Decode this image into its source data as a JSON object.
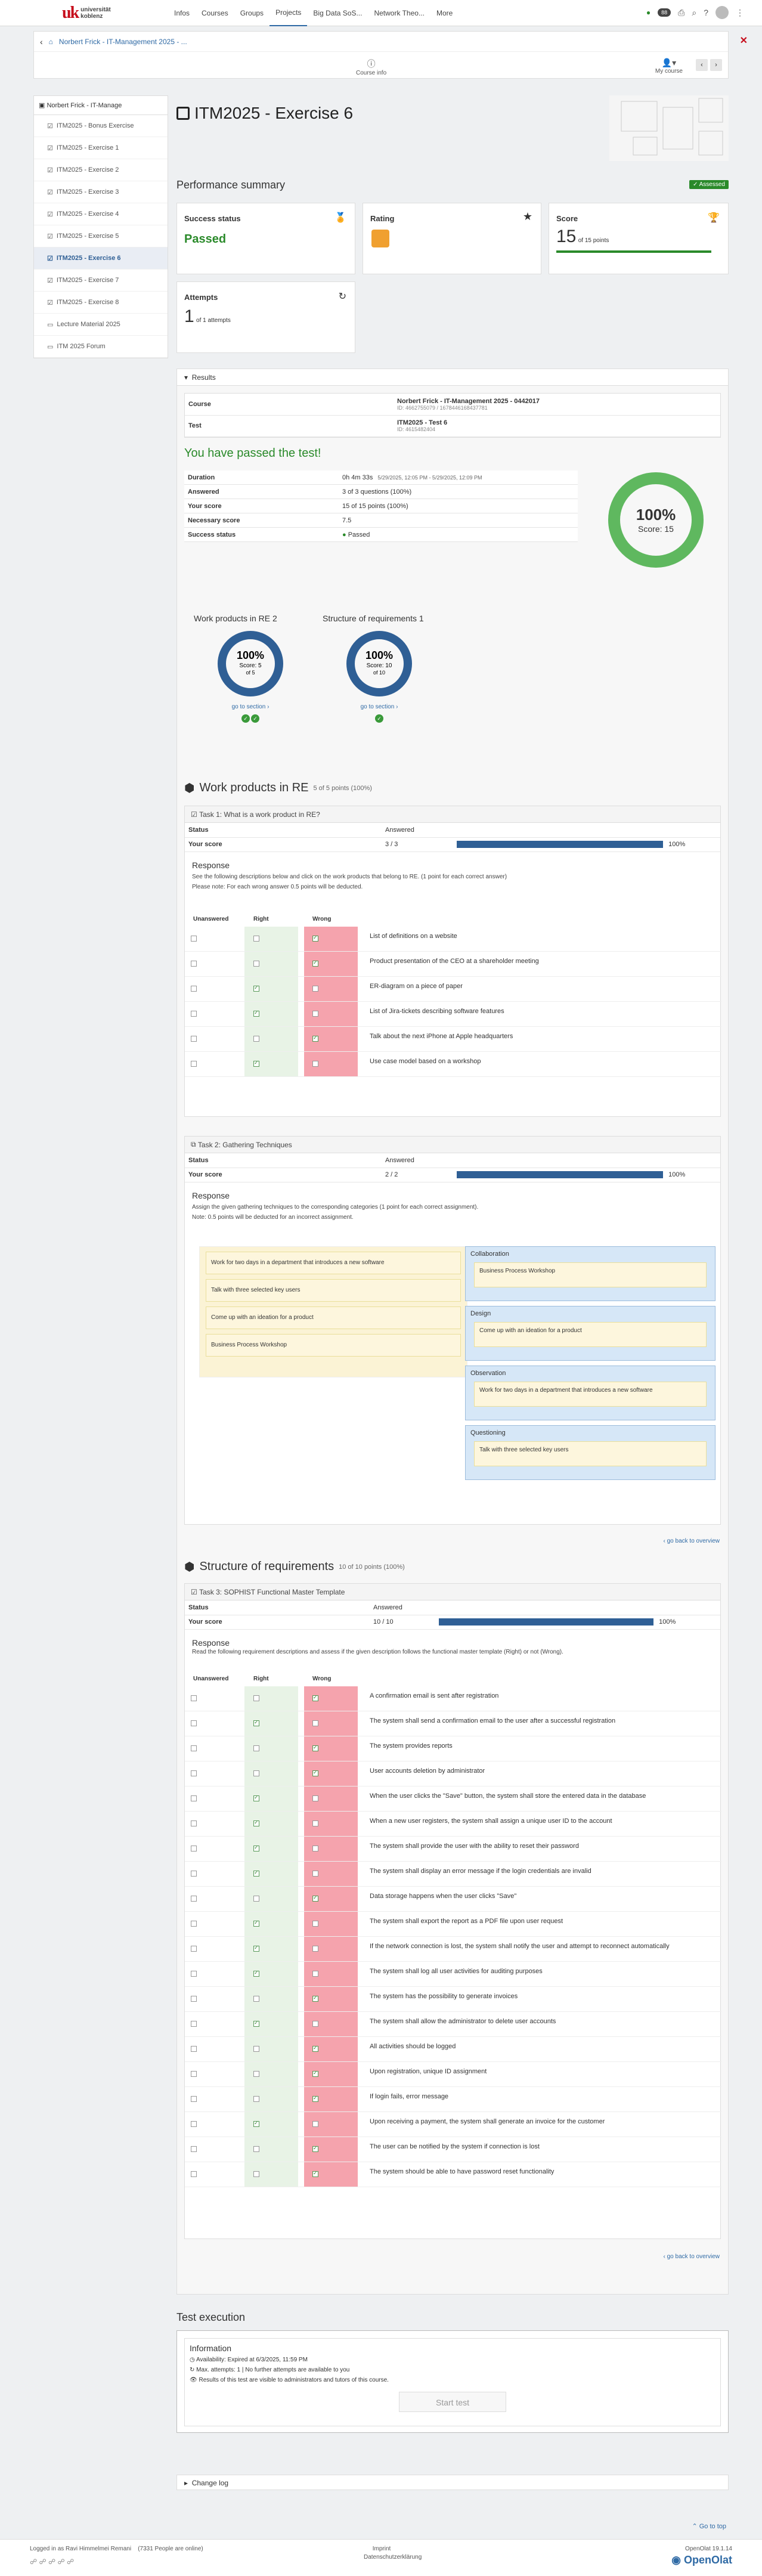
{
  "topbar": {
    "logo_short": "uk",
    "logo_line1": "universität",
    "logo_line2": "koblenz",
    "nav": [
      "Infos",
      "Courses",
      "Groups",
      "Projects",
      "Big Data SoS...",
      "Network Theo...",
      "More"
    ],
    "badge": "88"
  },
  "crumb": {
    "back": "‹",
    "course": "Norbert Frick - IT-Management 2025 - ...",
    "course_info": "Course info",
    "my_course": "My course",
    "prev": "‹",
    "next": "›"
  },
  "sidebar": {
    "title": "Norbert Frick - IT-Manage",
    "items": [
      "ITM2025 - Bonus Exercise",
      "ITM2025 - Exercise 1",
      "ITM2025 - Exercise 2",
      "ITM2025 - Exercise 3",
      "ITM2025 - Exercise 4",
      "ITM2025 - Exercise 5",
      "ITM2025 - Exercise 6",
      "ITM2025 - Exercise 7",
      "ITM2025 - Exercise 8",
      "Lecture Material 2025",
      "ITM 2025 Forum"
    ],
    "selected": 6
  },
  "page": {
    "title": "ITM2025 - Exercise 6",
    "perf": "Performance summary",
    "assessed": "Assessed"
  },
  "cards": {
    "success_label": "Success status",
    "success_value": "Passed",
    "rating_label": "Rating",
    "score_label": "Score",
    "score_value": "15",
    "score_of": "of 15 points",
    "attempts_label": "Attempts",
    "attempts_value": "1",
    "attempts_of": "of 1 attempts"
  },
  "results": {
    "toggle": "Results",
    "course_k": "Course",
    "course_v": "Norbert Frick - IT-Management 2025 - 0442017",
    "course_id": "ID: 4662755079 / 1678446168437781",
    "test_k": "Test",
    "test_v": "ITM2025 - Test 6",
    "test_id": "ID: 4615482404",
    "passed": "You have passed the test!",
    "rows": [
      {
        "k": "Duration",
        "v": "0h 4m 33s",
        "v2": "5/29/2025, 12:05 PM - 5/29/2025, 12:09 PM"
      },
      {
        "k": "Answered",
        "v": "3 of 3 questions (100%)"
      },
      {
        "k": "Your score",
        "v": "15 of 15 points (100%)"
      },
      {
        "k": "Necessary score",
        "v": "7.5"
      },
      {
        "k": "Success status",
        "v": "Passed"
      }
    ],
    "donut_pct": "100%",
    "donut_score": "Score: 15",
    "sections": [
      {
        "title": "Work products in RE 2",
        "pct": "100%",
        "score": "Score: 5",
        "of": "of 5",
        "goto": "go to section"
      },
      {
        "title": "Structure of requirements 1",
        "pct": "100%",
        "score": "Score: 10",
        "of": "of 10",
        "goto": "go to section"
      }
    ]
  },
  "sec1": {
    "title": "Work products in RE",
    "sub": "5 of 5 points (100%)"
  },
  "task1": {
    "title": "Task 1: What is a work product in RE?",
    "status_k": "Status",
    "status_v": "Answered",
    "score_k": "Your score",
    "score_v": "3 / 3",
    "pct": "100%",
    "resp": "Response",
    "d1": "See the following descriptions below and click on the work products that belong to RE. (1 point for each correct answer)",
    "d2": "Please note: For each wrong answer 0.5 points will be deducted.",
    "h": [
      "Unanswered",
      "Right",
      "Wrong"
    ],
    "rows": [
      "List of definitions on a website",
      "Product presentation of the CEO at a shareholder meeting",
      "ER-diagram on a piece of paper",
      "List of Jira-tickets describing software features",
      "Talk about the next iPhone at Apple headquarters",
      "Use case model based on a workshop"
    ]
  },
  "task2": {
    "title": "Task 2: Gathering Techniques",
    "status_k": "Status",
    "status_v": "Answered",
    "score_k": "Your score",
    "score_v": "2 / 2",
    "pct": "100%",
    "resp": "Response",
    "d1": "Assign the given gathering techniques to the corresponding categories (1 point for each correct assignment).",
    "d2": "Note: 0.5 points will be deducted for an incorrect assignment.",
    "pool": [
      "Work for two days in a department that introduces a new software",
      "Talk with three selected key users",
      "Come up with an ideation for a product",
      "Business Process Workshop"
    ],
    "cats": [
      {
        "name": "Collaboration",
        "item": "Business Process Workshop"
      },
      {
        "name": "Design",
        "item": "Come up with an ideation for a product"
      },
      {
        "name": "Observation",
        "item": "Work for two days in a department that introduces a new software"
      },
      {
        "name": "Questioning",
        "item": "Talk with three selected key users"
      }
    ],
    "back": "go back to overview"
  },
  "sec2": {
    "title": "Structure of requirements",
    "sub": "10 of 10 points (100%)"
  },
  "task3": {
    "title": "Task 3: SOPHIST Functional Master Template",
    "status_k": "Status",
    "status_v": "Answered",
    "score_k": "Your score",
    "score_v": "10 / 10",
    "pct": "100%",
    "resp": "Response",
    "d1": "Read the following requirement descriptions and assess if the given description follows the functional master template (Right) or not (Wrong).",
    "h": [
      "Unanswered",
      "Right",
      "Wrong"
    ],
    "rows": [
      "A confirmation email is sent after registration",
      "The system shall send a confirmation email to the user after a successful registration",
      "The system provides reports",
      "User accounts deletion by administrator",
      "When the user clicks the \"Save\" button, the system shall store the entered data in the database",
      "When a new user registers, the system shall assign a unique user ID to the account",
      "The system shall provide the user with the ability to reset their password",
      "The system shall display an error message if the login credentials are invalid",
      "Data storage happens when the user clicks \"Save\"",
      "The system shall export the report as a PDF file upon user request",
      "If the network connection is lost, the system shall notify the user and attempt to reconnect automatically",
      "The system shall log all user activities for auditing purposes",
      "The system has the possibility to generate invoices",
      "The system shall allow the administrator to delete user accounts",
      "All activities should be logged",
      "Upon registration, unique ID assignment",
      "If login fails, error message",
      "Upon receiving a payment, the system shall generate an invoice for the customer",
      "The user can be notified by the system if connection is lost",
      "The system should be able to have password reset functionality"
    ],
    "right": [
      1,
      4,
      5,
      6,
      7,
      9,
      10,
      11,
      13,
      17
    ],
    "back": "go back to overview"
  },
  "exec": {
    "title": "Test execution",
    "info": "Information",
    "l1": "Availability: Expired at 6/3/2025, 11:59 PM",
    "l2": "Max. attempts: 1 | No further attempts are available to you",
    "l3": "Results of this test are visible to administrators and tutors of this course.",
    "start": "Start test",
    "changelog": "Change log"
  },
  "footer": {
    "goto": "Go to top",
    "user": "Logged in as Ravi Himmelmei Remani",
    "online": "(7331 People are online)",
    "imprint": "Imprint",
    "privacy": "Datenschutzerklärung",
    "version": "OpenOlat 19.1.14",
    "brand": "OpenOlat"
  }
}
